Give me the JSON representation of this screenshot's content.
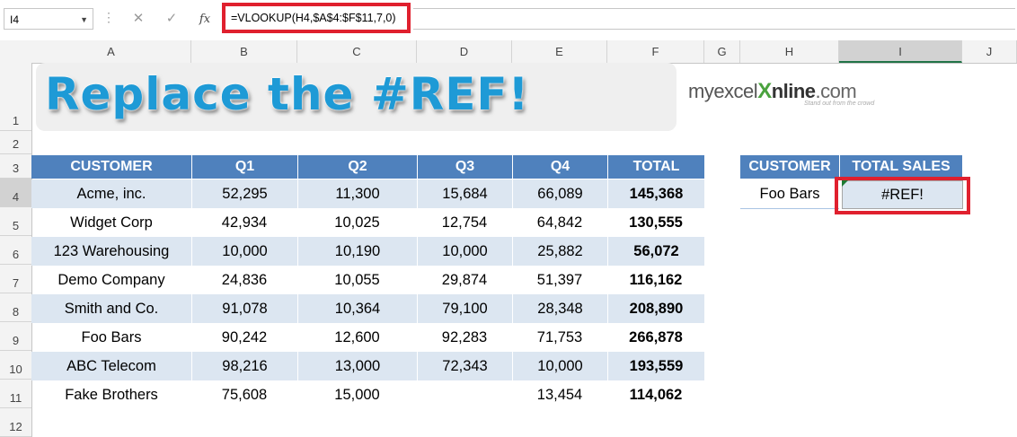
{
  "name_box": "I4",
  "formula": "=VLOOKUP(H4,$A$4:$F$11,7,0)",
  "fx_label": "fx",
  "columns": [
    "A",
    "B",
    "C",
    "D",
    "E",
    "F",
    "G",
    "H",
    "I",
    "J"
  ],
  "rows": [
    "1",
    "2",
    "3",
    "4",
    "5",
    "6",
    "7",
    "8",
    "9",
    "10",
    "11",
    "12"
  ],
  "banner": {
    "title": "Replace the #REF!",
    "logo_my": "myexcel",
    "logo_x": "X",
    "logo_online": "nline",
    "logo_com": ".com",
    "logo_tagline": "Stand out from the crowd"
  },
  "table": {
    "headers": [
      "CUSTOMER",
      "Q1",
      "Q2",
      "Q3",
      "Q4",
      "TOTAL"
    ],
    "rows": [
      [
        "Acme, inc.",
        "52,295",
        "11,300",
        "15,684",
        "66,089",
        "145,368"
      ],
      [
        "Widget Corp",
        "42,934",
        "10,025",
        "12,754",
        "64,842",
        "130,555"
      ],
      [
        "123 Warehousing",
        "10,000",
        "10,190",
        "10,000",
        "25,882",
        "56,072"
      ],
      [
        "Demo Company",
        "24,836",
        "10,055",
        "29,874",
        "51,397",
        "116,162"
      ],
      [
        "Smith and Co.",
        "91,078",
        "10,364",
        "79,100",
        "28,348",
        "208,890"
      ],
      [
        "Foo Bars",
        "90,242",
        "12,600",
        "92,283",
        "71,753",
        "266,878"
      ],
      [
        "ABC Telecom",
        "98,216",
        "13,000",
        "72,343",
        "10,000",
        "193,559"
      ],
      [
        "Fake Brothers",
        "75,608",
        "15,000",
        "13,454",
        "114,062"
      ]
    ]
  },
  "lookup": {
    "headers": [
      "CUSTOMER",
      "TOTAL SALES"
    ],
    "customer": "Foo Bars",
    "result": "#REF!"
  },
  "colors": {
    "header_blue": "#4f81bd",
    "band_blue": "#dce6f1",
    "highlight_red": "#e0202e",
    "title_blue": "#1e9ad6"
  }
}
